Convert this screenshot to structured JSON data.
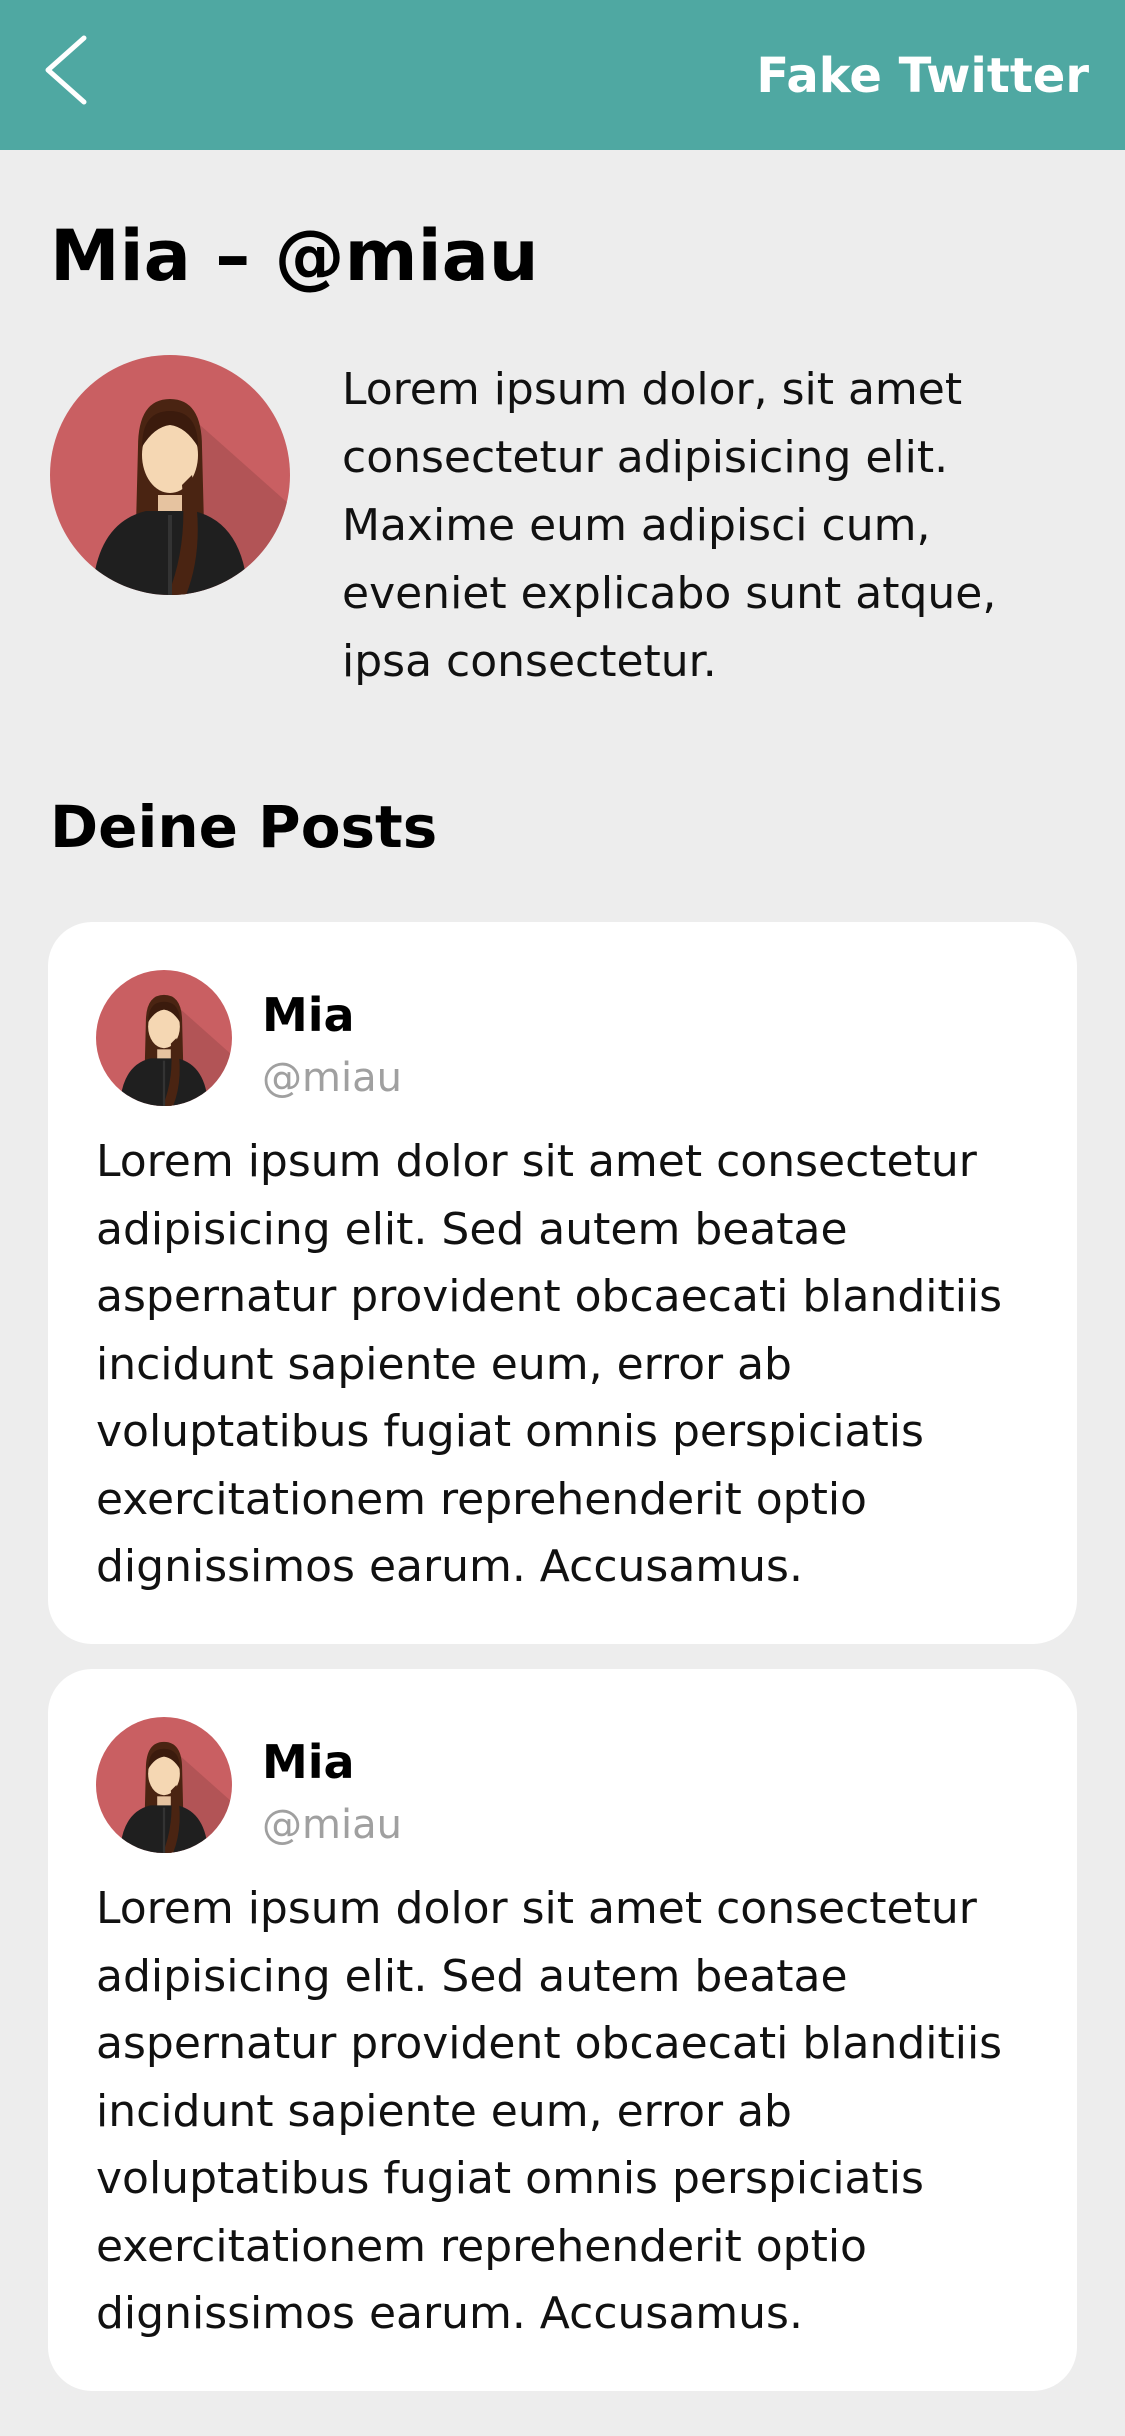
{
  "header": {
    "back_icon": "chevron-left-icon",
    "title": "Fake Twitter",
    "background_color": "#4fa8a2"
  },
  "profile": {
    "title": "Mia – @miau",
    "avatar_icon": "woman-avatar-icon",
    "avatar_color": "#c95f62",
    "bio": "Lorem ipsum dolor, sit amet consectetur adipisicing elit. Maxime eum adipisci cum, eveniet explicabo sunt atque, ipsa consectetur."
  },
  "posts_section": {
    "title": "Deine Posts"
  },
  "posts": [
    {
      "name": "Mia",
      "handle": "@miau",
      "text": "Lorem ipsum dolor sit amet consectetur adipisicing elit. Sed autem beatae aspernatur provident obcaecati blanditiis incidunt sapiente eum, error ab voluptatibus fugiat omnis perspiciatis exercitationem reprehenderit optio dignissimos earum. Accusamus."
    },
    {
      "name": "Mia",
      "handle": "@miau",
      "text": "Lorem ipsum dolor sit amet consectetur adipisicing elit. Sed autem beatae aspernatur provident obcaecati blanditiis incidunt sapiente eum, error ab voluptatibus fugiat omnis perspiciatis exercitationem reprehenderit optio dignissimos earum. Accusamus."
    }
  ],
  "colors": {
    "page_background": "#ededed",
    "card_background": "#ffffff",
    "handle_gray": "#a0a0a0"
  }
}
